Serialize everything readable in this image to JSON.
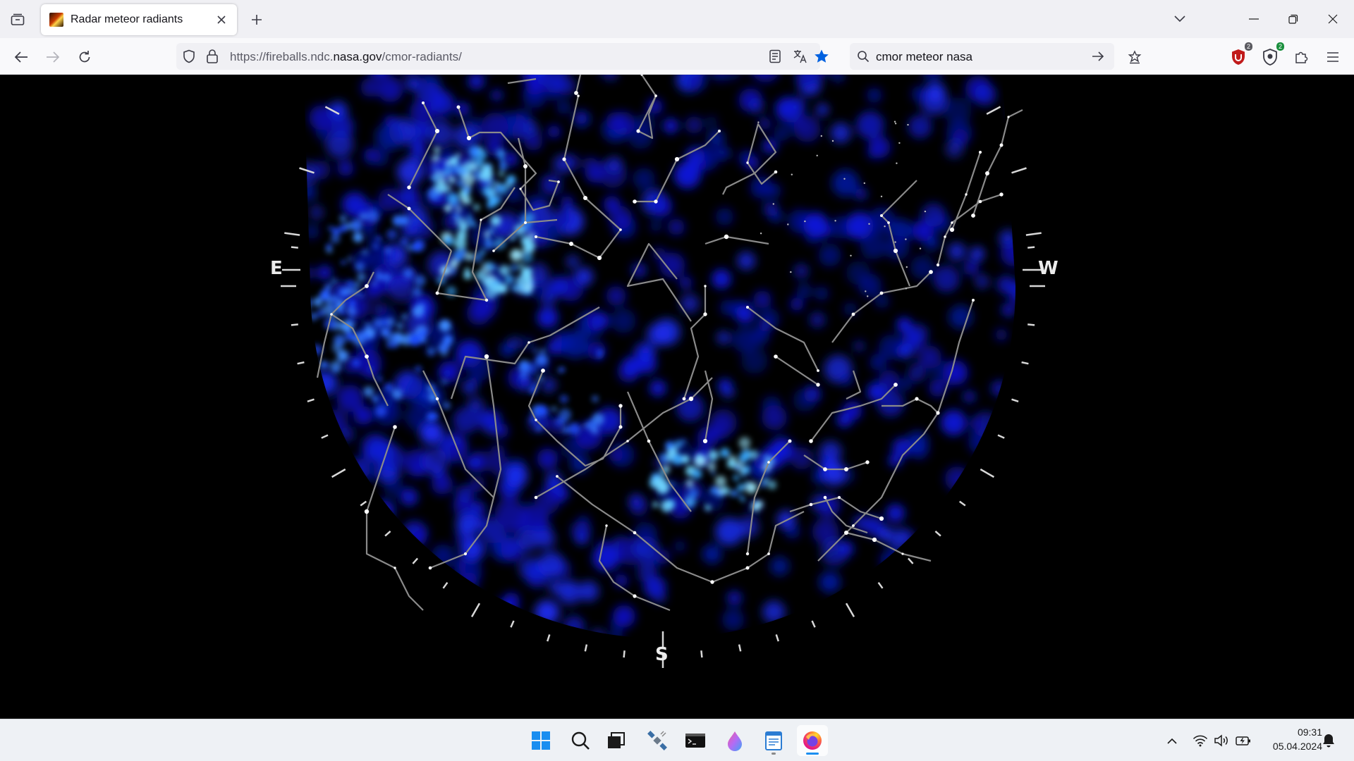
{
  "browser": {
    "tab": {
      "title": "Radar meteor radiants",
      "favicon": "meteor-favicon"
    },
    "url": {
      "prefix": "https://fireballs.ndc.",
      "host": "nasa.gov",
      "path": "/cmor-radiants/"
    },
    "search": {
      "value": "cmor meteor nasa"
    },
    "extensions": [
      {
        "name": "ublock-origin-icon",
        "badge": "2",
        "color": "#c11b1b"
      },
      {
        "name": "shield-extension-icon",
        "badge": "2",
        "color": "#1a8f3d"
      }
    ],
    "accent": "#0061e0"
  },
  "page": {
    "compass": {
      "east": "E",
      "west": "W",
      "south": "S"
    },
    "background": "#000000"
  },
  "taskbar": {
    "apps": [
      "windows-start-icon",
      "search-icon",
      "task-view-icon",
      "satellite-app-icon",
      "terminal-icon",
      "paint-drop-icon",
      "notepad-icon",
      "firefox-icon"
    ],
    "clock": {
      "time": "09:31",
      "date": "05.04.2024"
    }
  }
}
